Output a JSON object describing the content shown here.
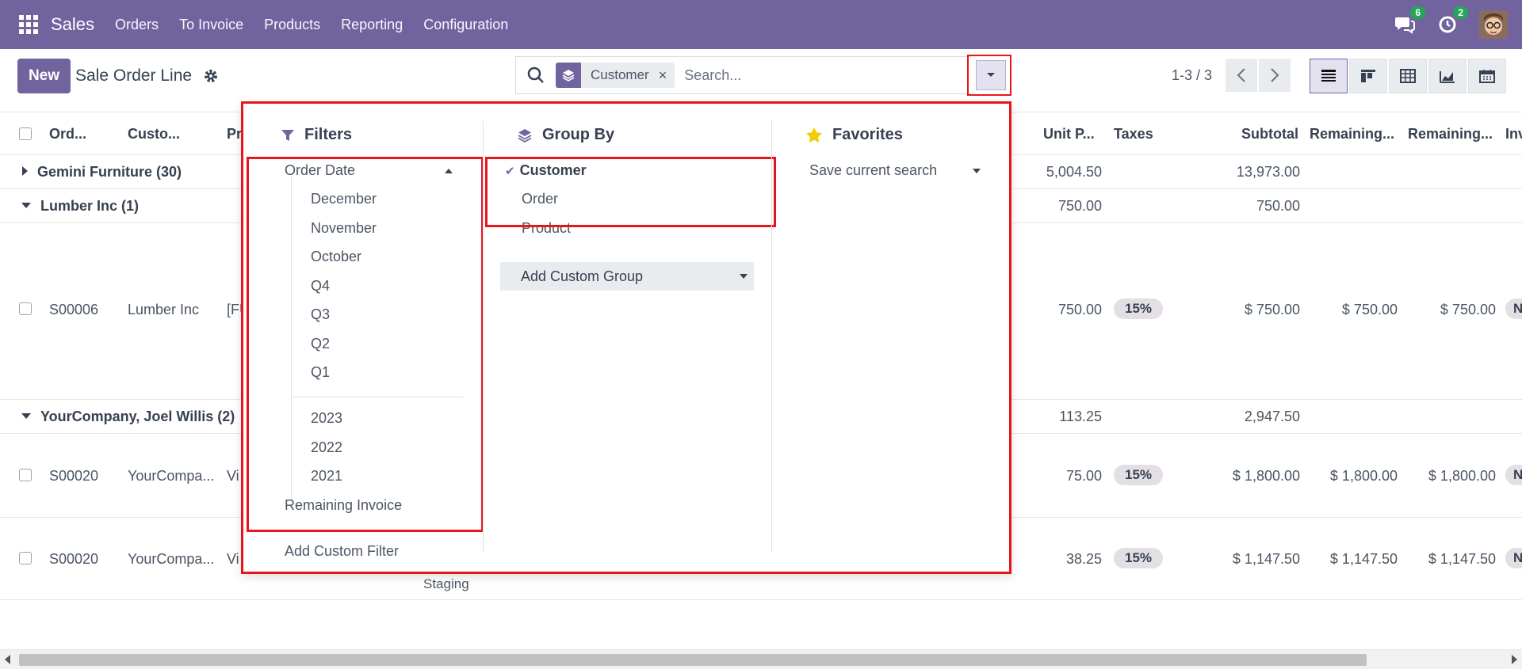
{
  "navbar": {
    "brand": "Sales",
    "menu": [
      "Orders",
      "To Invoice",
      "Products",
      "Reporting",
      "Configuration"
    ],
    "messages_count": "6",
    "activities_count": "2",
    "bg_color": "#71639e"
  },
  "control_panel": {
    "new_label": "New",
    "title": "Sale Order Line",
    "search": {
      "facet_label": "Customer",
      "facet_close": "×",
      "placeholder": "Search..."
    },
    "pager": "1-3 / 3"
  },
  "table": {
    "headers": [
      "Ord...",
      "Custo...",
      "Pr",
      "Unit P...",
      "Taxes",
      "Subtotal",
      "Remaining...",
      "Remaining...",
      "Inv"
    ],
    "groups": [
      {
        "label": "Gemini Furniture (30)",
        "unit_price": "5,004.50",
        "subtotal": "13,973.00",
        "expanded": false
      },
      {
        "label": "Lumber Inc (1)",
        "unit_price": "750.00",
        "subtotal": "750.00",
        "expanded": true
      },
      {
        "label": "YourCompany, Joel Willis (2)",
        "unit_price": "113.25",
        "subtotal": "2,947.50",
        "expanded": true
      }
    ],
    "rows": [
      {
        "order": "S00006",
        "customer": "Lumber Inc",
        "product": "[FU",
        "unit_price": "750.00",
        "tax": "15%",
        "subtotal": "$ 750.00",
        "rem1": "$ 750.00",
        "rem2": "$ 750.00",
        "inv": "N"
      },
      {
        "order": "S00020",
        "customer": "YourCompa...",
        "product": "Vi",
        "unit_price": "75.00",
        "tax": "15%",
        "subtotal": "$ 1,800.00",
        "rem1": "$ 1,800.00",
        "rem2": "$ 1,800.00",
        "inv": "N"
      },
      {
        "order": "S00020",
        "customer": "YourCompa...",
        "product": "Vi",
        "unit_price": "38.25",
        "tax": "15%",
        "subtotal": "$ 1,147.50",
        "rem1": "$ 1,147.50",
        "rem2": "$ 1,147.50",
        "inv": "N"
      }
    ],
    "partial_text": "Staging"
  },
  "dropdown": {
    "filters": {
      "title": "Filters",
      "order_date": "Order Date",
      "months": [
        "December",
        "November",
        "October"
      ],
      "quarters": [
        "Q4",
        "Q3",
        "Q2",
        "Q1"
      ],
      "years": [
        "2023",
        "2022",
        "2021"
      ],
      "remaining_invoice": "Remaining Invoice",
      "add_custom_filter": "Add Custom Filter"
    },
    "group_by": {
      "title": "Group By",
      "options": [
        "Customer",
        "Order",
        "Product"
      ],
      "selected": "Customer",
      "add_custom_group": "Add Custom Group"
    },
    "favorites": {
      "title": "Favorites",
      "save_current_search": "Save current search"
    }
  },
  "colors": {
    "primary": "#71639e",
    "highlight": "#e8161c",
    "star": "#f3cc00"
  }
}
